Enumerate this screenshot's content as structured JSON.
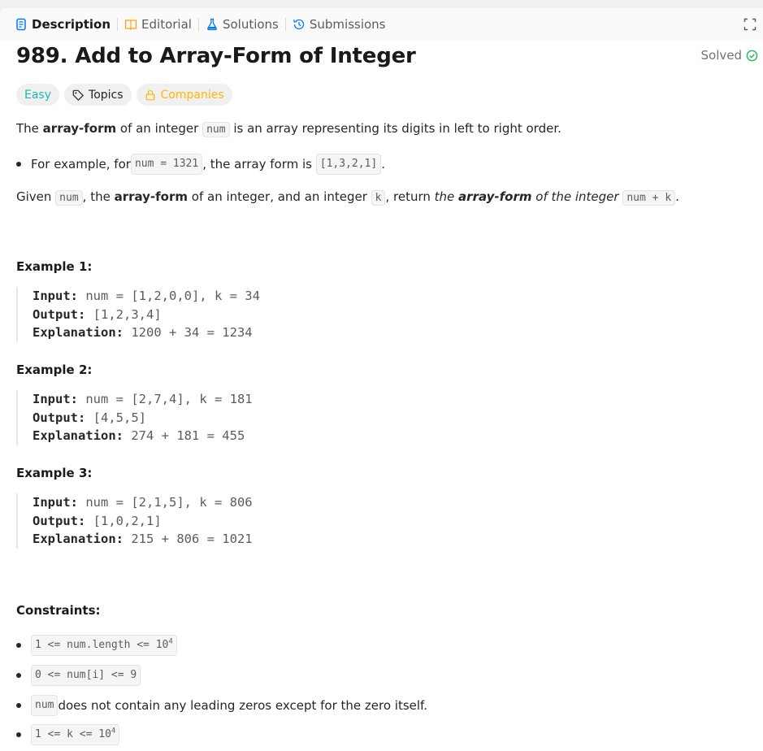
{
  "tabs": [
    {
      "label": "Description",
      "active": true,
      "icon": "description-icon"
    },
    {
      "label": "Editorial",
      "active": false,
      "icon": "book-icon"
    },
    {
      "label": "Solutions",
      "active": false,
      "icon": "flask-icon"
    },
    {
      "label": "Submissions",
      "active": false,
      "icon": "history-icon"
    }
  ],
  "problem": {
    "title": "989. Add to Array-Form of Integer",
    "status": "Solved",
    "tags": {
      "difficulty": "Easy",
      "topics": "Topics",
      "companies": "Companies"
    },
    "colors": {
      "easy": "#1cb8b8",
      "companies": "#ffb800",
      "solved": "#2cbb5d",
      "accent": "#007aff"
    }
  },
  "description": {
    "p1": {
      "pre": "The ",
      "bold": "array-form",
      "mid": " of an integer ",
      "code": "num",
      "post": " is an array representing its digits in left to right order."
    },
    "bullet": {
      "pre": "For example, for ",
      "code1": "num = 1321",
      "mid": ", the array form is ",
      "code2": "[1,3,2,1]",
      "post": "."
    },
    "p2": {
      "pre": "Given ",
      "code1": "num",
      "mid1": ", the ",
      "bold1": "array-form",
      "mid2": " of an integer, and an integer ",
      "code2": "k",
      "mid3": ", return ",
      "italic1": "the ",
      "bolditalic": "array-form",
      "italic2": " of the integer ",
      "code3": "num + k",
      "post": "."
    }
  },
  "examples": [
    {
      "heading": "Example 1:",
      "input_label": "Input:",
      "input": "num = [1,2,0,0], k = 34",
      "output_label": "Output:",
      "output": "[1,2,3,4]",
      "explanation_label": "Explanation:",
      "explanation": "1200 + 34 = 1234"
    },
    {
      "heading": "Example 2:",
      "input_label": "Input:",
      "input": "num = [2,7,4], k = 181",
      "output_label": "Output:",
      "output": "[4,5,5]",
      "explanation_label": "Explanation:",
      "explanation": "274 + 181 = 455"
    },
    {
      "heading": "Example 3:",
      "input_label": "Input:",
      "input": "num = [2,1,5], k = 806",
      "output_label": "Output:",
      "output": "[1,0,2,1]",
      "explanation_label": "Explanation:",
      "explanation": "215 + 806 = 1021"
    }
  ],
  "constraints": {
    "heading": "Constraints:",
    "c1": {
      "code": "1 <= num.length <= 10",
      "sup": "4"
    },
    "c2": {
      "code": "0 <= num[i] <= 9"
    },
    "c3": {
      "code": "num",
      "text": " does not contain any leading zeros except for the zero itself."
    },
    "c4": {
      "code": "1 <= k <= 10",
      "sup": "4"
    }
  }
}
